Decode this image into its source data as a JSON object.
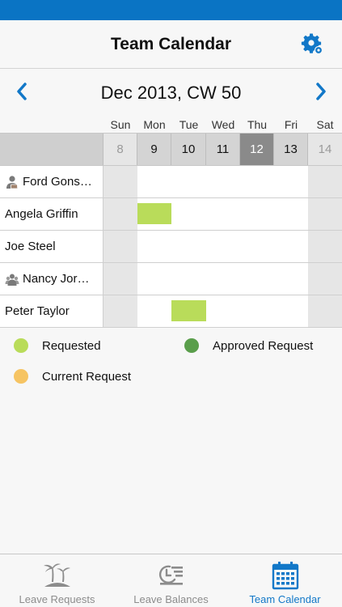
{
  "header": {
    "title": "Team Calendar",
    "settings_icon": "gear-icon"
  },
  "calendar": {
    "period": "Dec 2013, CW 50",
    "prev_icon": "chevron-left-icon",
    "next_icon": "chevron-right-icon",
    "day_names": [
      "Sun",
      "Mon",
      "Tue",
      "Wed",
      "Thu",
      "Fri",
      "Sat"
    ],
    "dates": [
      "8",
      "9",
      "10",
      "11",
      "12",
      "13",
      "14"
    ],
    "today_index": 4,
    "weekend_indices": [
      0,
      6
    ]
  },
  "team": [
    {
      "name": "Ford Gons…",
      "icon": "manager-icon",
      "leave": []
    },
    {
      "name": "Angela Griffin",
      "icon": "",
      "leave": [
        {
          "day_index": 1,
          "status": "requested"
        }
      ]
    },
    {
      "name": "Joe Steel",
      "icon": "",
      "leave": []
    },
    {
      "name": "Nancy Jor…",
      "icon": "team-icon",
      "leave": []
    },
    {
      "name": "Peter Taylor",
      "icon": "",
      "leave": [
        {
          "day_index": 2,
          "status": "requested"
        }
      ]
    }
  ],
  "legend": {
    "requested": "Requested",
    "approved": "Approved Request",
    "current": "Current Request"
  },
  "colors": {
    "accent": "#1278c8",
    "status_bar": "#0a74c4",
    "requested": "#b9dc5a",
    "approved": "#5a9e4b",
    "current": "#f6c463",
    "today": "#8a8a8a"
  },
  "tabs": [
    {
      "label": "Leave Requests",
      "icon": "palm-island-icon",
      "active": false
    },
    {
      "label": "Leave Balances",
      "icon": "balance-clock-icon",
      "active": false
    },
    {
      "label": "Team Calendar",
      "icon": "calendar-icon",
      "active": true
    }
  ]
}
